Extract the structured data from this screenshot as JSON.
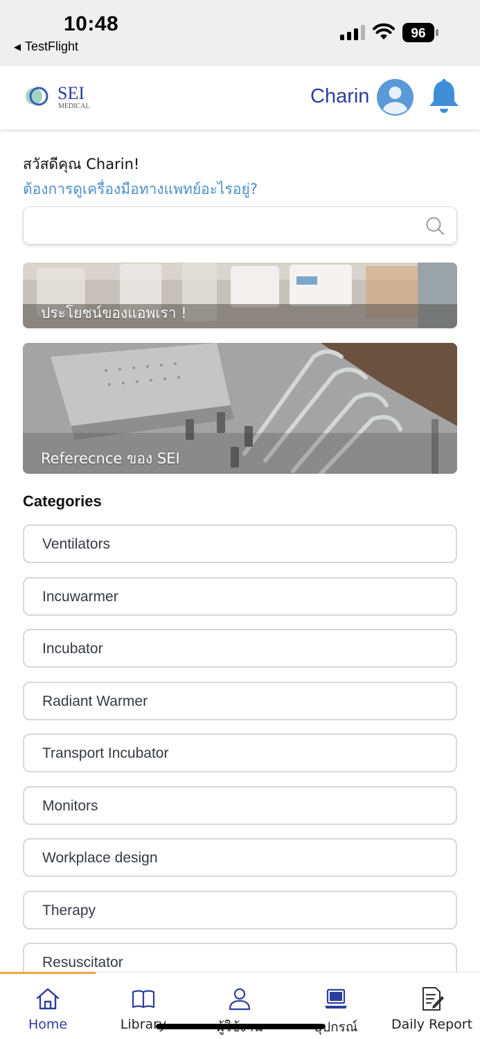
{
  "status_bar": {
    "time": "10:48",
    "back_app": "TestFlight",
    "battery": "96"
  },
  "header": {
    "logo_text": "SEI",
    "logo_sub": "MEDICAL",
    "user_name": "Charin"
  },
  "greeting": {
    "hello": "สวัสดีคุณ Charin!",
    "question": "ต้องการดูเครื่องมือทางแพทย์อะไรอยู่?"
  },
  "search": {
    "placeholder": ""
  },
  "banners": [
    {
      "caption": "ประโยชน์ของแอพเรา !"
    },
    {
      "caption": "Referecnce ของ SEI"
    }
  ],
  "categories": {
    "title": "Categories",
    "items": [
      "Ventilators",
      "Incuwarmer",
      "Incubator",
      "Radiant Warmer",
      "Transport Incubator",
      "Monitors",
      "Workplace design",
      "Therapy",
      "Resuscitator"
    ]
  },
  "bottom_nav": {
    "items": [
      {
        "label": "Home",
        "icon": "home-icon",
        "active": true
      },
      {
        "label": "Library",
        "icon": "book-icon",
        "active": false
      },
      {
        "label": "ผู้ใช้งาน",
        "icon": "user-icon",
        "active": false
      },
      {
        "label": "อุปกรณ์",
        "icon": "laptop-icon",
        "active": false
      },
      {
        "label": "Daily Report",
        "icon": "report-icon",
        "active": false
      }
    ]
  },
  "colors": {
    "brand": "#2d3d9b",
    "accent": "#4a90c8",
    "nav_indicator": "#f2a444"
  }
}
